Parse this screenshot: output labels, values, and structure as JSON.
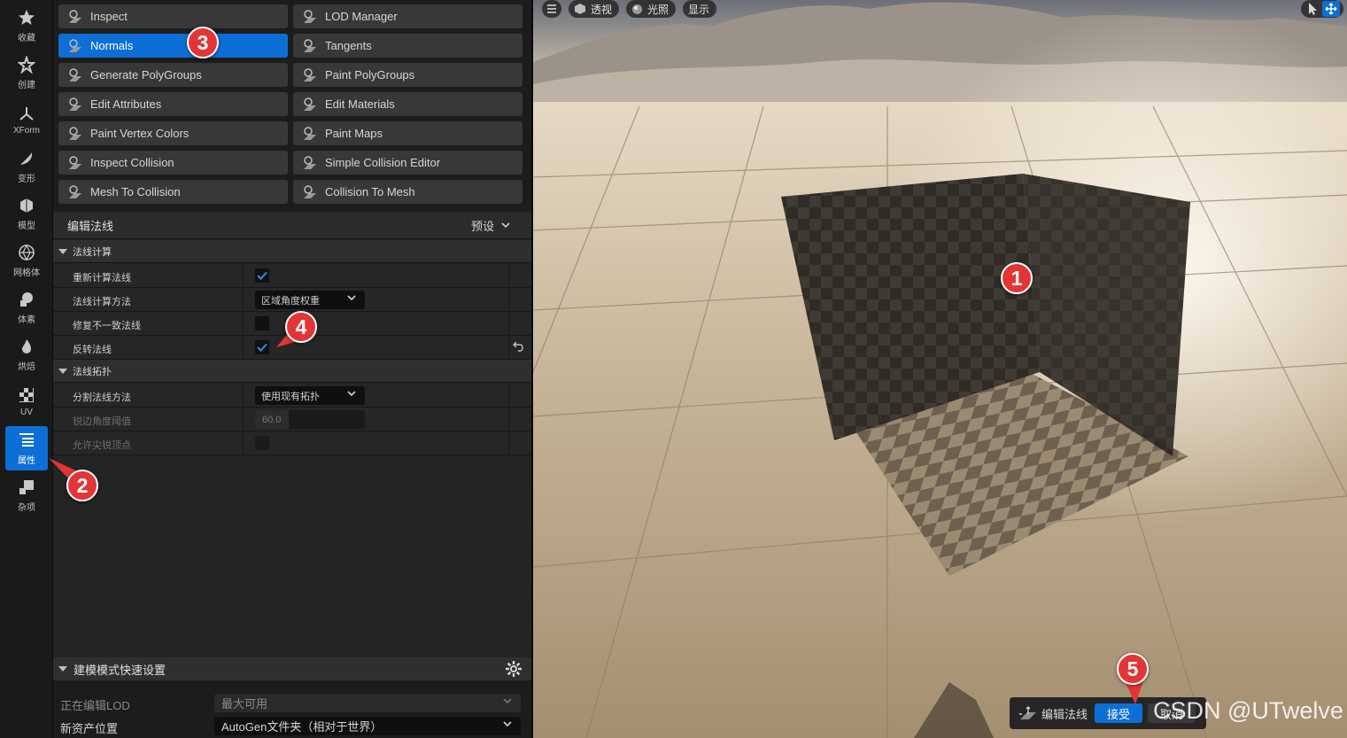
{
  "sidebar": {
    "items": [
      {
        "label": "收藏",
        "icon": "star-icon"
      },
      {
        "label": "创建",
        "icon": "create-icon"
      },
      {
        "label": "XForm",
        "icon": "xform-axes-icon"
      },
      {
        "label": "变形",
        "icon": "deform-icon"
      },
      {
        "label": "模型",
        "icon": "model-icon"
      },
      {
        "label": "网格体",
        "icon": "mesh-icon"
      },
      {
        "label": "体素",
        "icon": "voxel-icon"
      },
      {
        "label": "烘焙",
        "icon": "bake-flame-icon"
      },
      {
        "label": "UV",
        "icon": "uv-checker-icon"
      },
      {
        "label": "属性",
        "icon": "attributes-list-icon"
      },
      {
        "label": "杂项",
        "icon": "misc-icon"
      }
    ],
    "active_index": 9
  },
  "tools": [
    {
      "label": "Inspect",
      "icon": "inspect-icon"
    },
    {
      "label": "LOD Manager",
      "icon": "lod-manager-icon"
    },
    {
      "label": "Normals",
      "icon": "normals-icon"
    },
    {
      "label": "Tangents",
      "icon": "tangents-icon"
    },
    {
      "label": "Generate PolyGroups",
      "icon": "generate-polygroups-icon"
    },
    {
      "label": "Paint PolyGroups",
      "icon": "paint-polygroups-icon"
    },
    {
      "label": "Edit Attributes",
      "icon": "edit-attributes-icon"
    },
    {
      "label": "Edit Materials",
      "icon": "edit-materials-icon"
    },
    {
      "label": "Paint Vertex Colors",
      "icon": "paint-vertex-colors-icon"
    },
    {
      "label": "Paint Maps",
      "icon": "paint-maps-icon"
    },
    {
      "label": "Inspect Collision",
      "icon": "inspect-collision-icon"
    },
    {
      "label": "Simple Collision Editor",
      "icon": "simple-collision-editor-icon"
    },
    {
      "label": "Mesh To Collision",
      "icon": "mesh-to-collision-icon"
    },
    {
      "label": "Collision To Mesh",
      "icon": "collision-to-mesh-icon"
    }
  ],
  "selected_tool": "Normals",
  "tool_panel": {
    "title": "编辑法线",
    "preset_label": "预设"
  },
  "sections": {
    "normal_calc": {
      "title": "法线计算",
      "recompute": {
        "label": "重新计算法线",
        "checked": true
      },
      "method": {
        "label": "法线计算方法",
        "value": "区域角度权重"
      },
      "fix_inconsistent": {
        "label": "修复不一致法线",
        "checked": false
      },
      "invert": {
        "label": "反转法线",
        "checked": true
      }
    },
    "normal_topology": {
      "title": "法线拓扑",
      "split_method": {
        "label": "分割法线方法",
        "value": "使用现有拓扑"
      },
      "sharp_edge_angle": {
        "label": "锐边角度阈值",
        "value": "60.0"
      },
      "allow_sharp_vertices": {
        "label": "允许尖锐顶点",
        "checked": false
      }
    }
  },
  "quick_settings": {
    "title": "建模模式快速设置",
    "editing_lod": {
      "label": "正在编辑LOD",
      "value": "最大可用"
    },
    "new_asset_location": {
      "label": "新资产位置",
      "value": "AutoGen文件夹（相对于世界）"
    }
  },
  "viewport": {
    "menu_icon": "hamburger-icon",
    "perspective_label": "透视",
    "lit_label": "光照",
    "show_label": "显示",
    "context_bar": {
      "tool_label": "编辑法线",
      "accept_label": "接受",
      "cancel_label": "取消"
    }
  },
  "callouts": [
    "1",
    "2",
    "3",
    "4",
    "5"
  ],
  "watermark": "CSDN @UTwelve",
  "colors": {
    "accent": "#0d6fd6",
    "callout": "#e33535"
  }
}
